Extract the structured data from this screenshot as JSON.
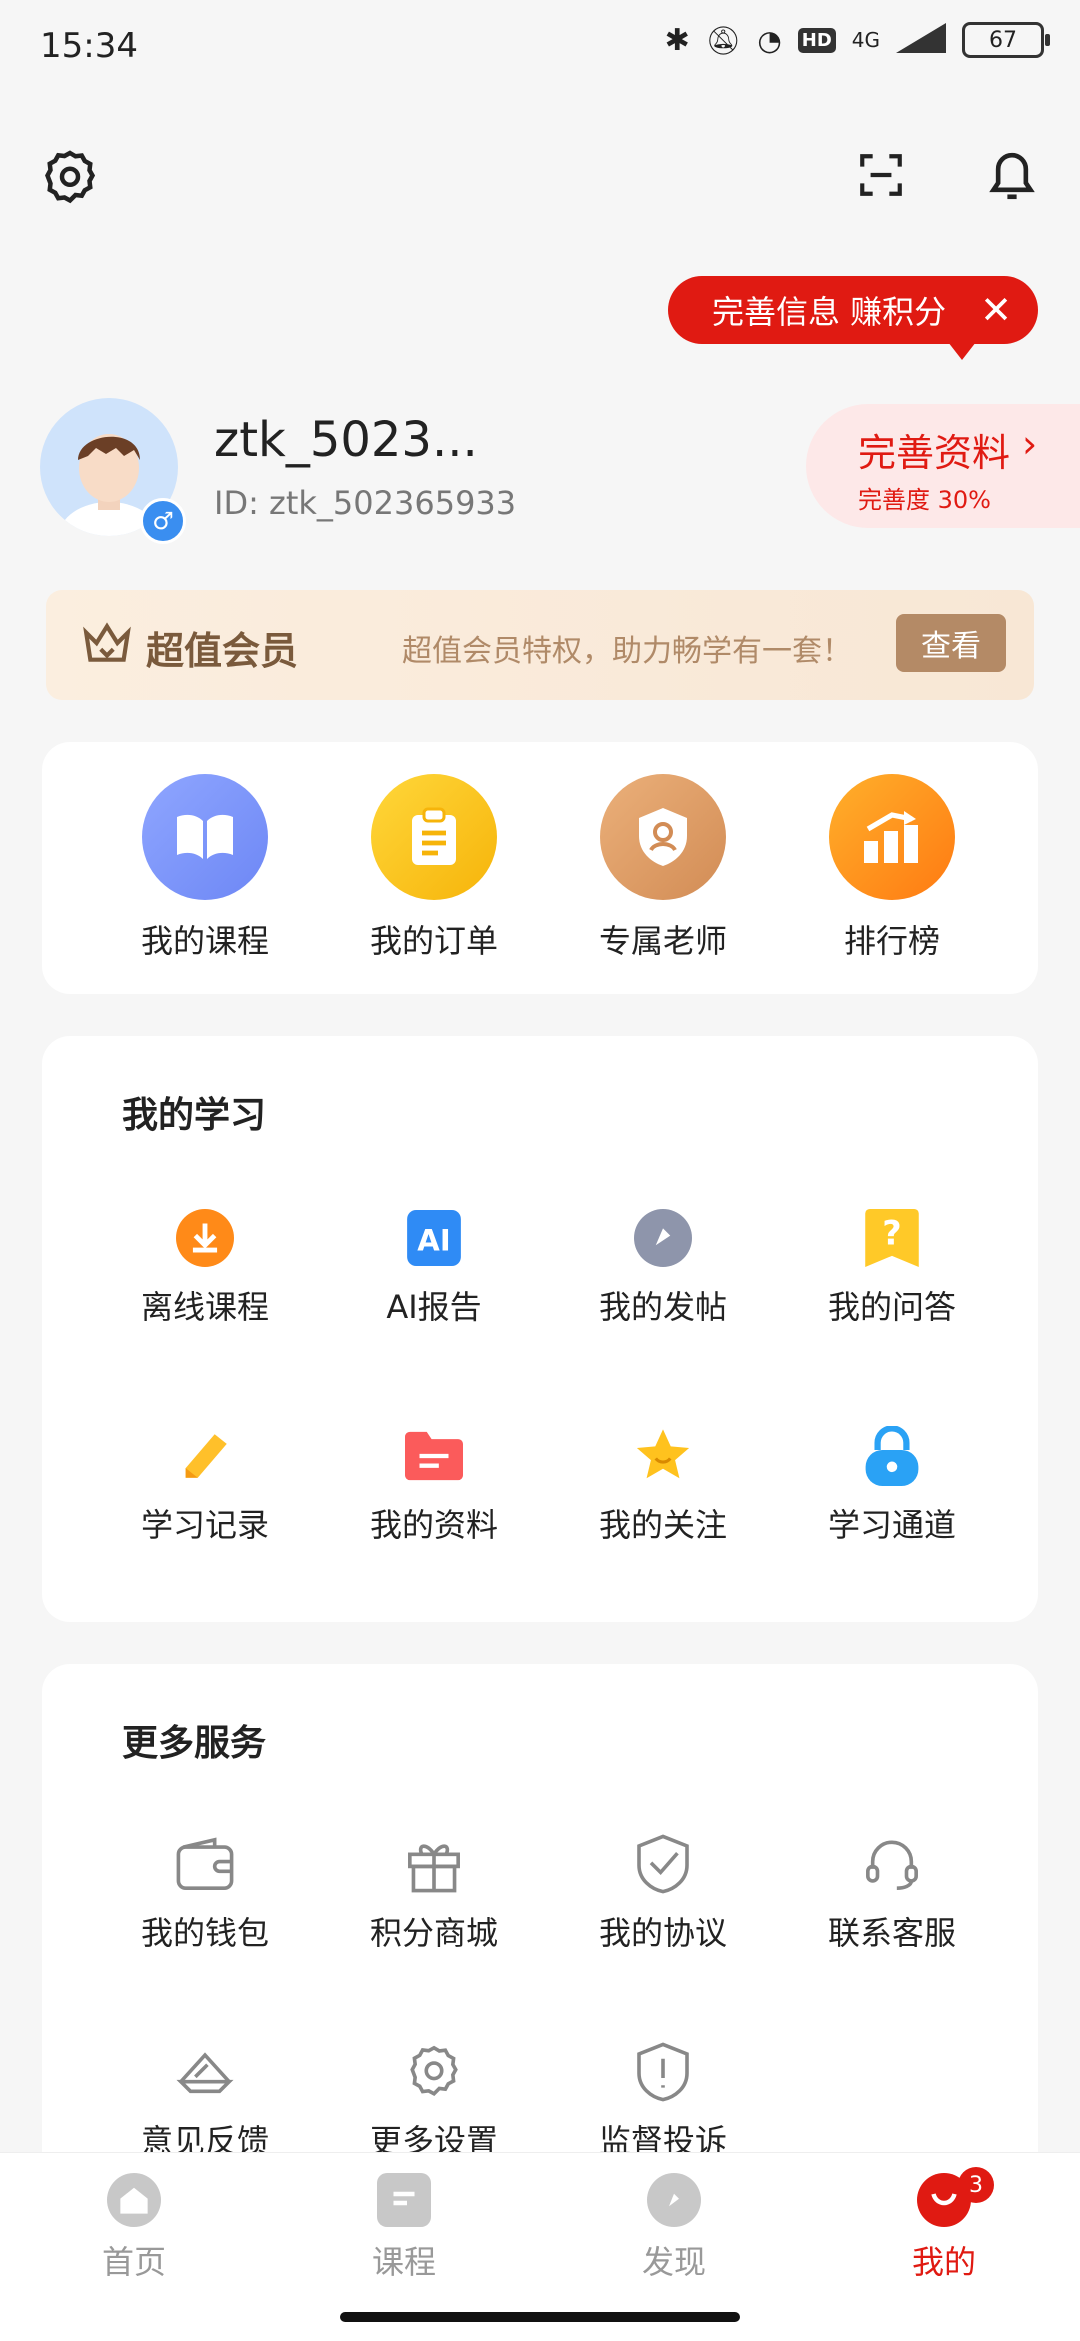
{
  "status_bar": {
    "time": "15:34",
    "network": "4G",
    "hd": "HD",
    "battery": "67"
  },
  "tooltip": {
    "text": "完善信息 赚积分"
  },
  "profile": {
    "name": "ztk_5023...",
    "id": "ID: ztk_502365933"
  },
  "complete_profile": {
    "title": "完善资料",
    "progress_label": "完善度 30%",
    "progress_value": 0.3
  },
  "vip": {
    "title": "超值会员",
    "desc": "超值会员特权，助力畅学有一套！",
    "button": "查看"
  },
  "quick_actions": [
    {
      "label": "我的课程",
      "icon": "book-icon"
    },
    {
      "label": "我的订单",
      "icon": "clipboard-icon"
    },
    {
      "label": "专属老师",
      "icon": "shield-teacher-icon"
    },
    {
      "label": "排行榜",
      "icon": "ranking-icon"
    }
  ],
  "study": {
    "title": "我的学习",
    "items": [
      {
        "label": "离线课程",
        "icon": "download-icon"
      },
      {
        "label": "AI报告",
        "icon": "ai-icon"
      },
      {
        "label": "我的发帖",
        "icon": "compass-icon"
      },
      {
        "label": "我的问答",
        "icon": "question-icon"
      },
      {
        "label": "学习记录",
        "icon": "pencil-icon"
      },
      {
        "label": "我的资料",
        "icon": "folder-icon"
      },
      {
        "label": "我的关注",
        "icon": "star-icon"
      },
      {
        "label": "学习通道",
        "icon": "lock-icon"
      }
    ]
  },
  "services": {
    "title": "更多服务",
    "items": [
      {
        "label": "我的钱包",
        "icon": "wallet-icon"
      },
      {
        "label": "积分商城",
        "icon": "gift-icon"
      },
      {
        "label": "我的协议",
        "icon": "shield-check-icon"
      },
      {
        "label": "联系客服",
        "icon": "headset-icon"
      },
      {
        "label": "意见反馈",
        "icon": "feedback-icon"
      },
      {
        "label": "更多设置",
        "icon": "gear-icon"
      },
      {
        "label": "监督投诉",
        "icon": "alert-shield-icon"
      }
    ]
  },
  "tabs": [
    {
      "label": "首页",
      "icon": "home-icon"
    },
    {
      "label": "课程",
      "icon": "course-icon"
    },
    {
      "label": "发现",
      "icon": "discover-icon"
    },
    {
      "label": "我的",
      "icon": "me-icon",
      "badge": "3"
    }
  ]
}
